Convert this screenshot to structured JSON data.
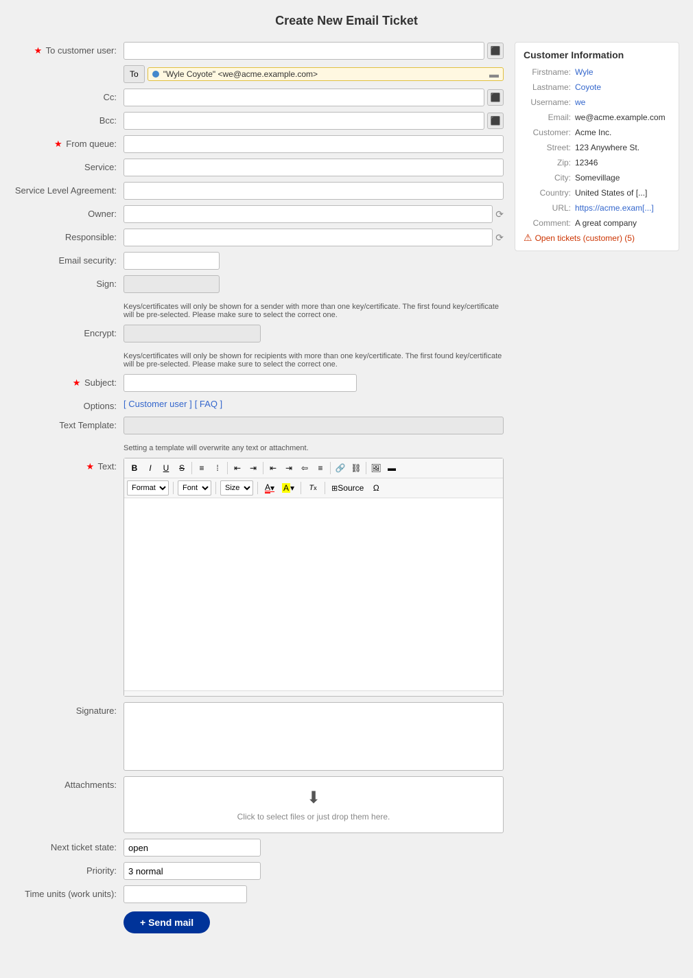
{
  "page": {
    "title": "Create New Email Ticket"
  },
  "form": {
    "to_customer_user_label": "To customer user:",
    "to_label": "To",
    "to_value": "\"Wyle Coyote\" <we@acme.example.com>",
    "cc_label": "Cc:",
    "bcc_label": "Bcc:",
    "from_queue_label": "From queue:",
    "service_label": "Service:",
    "sla_label": "Service Level Agreement:",
    "owner_label": "Owner:",
    "responsible_label": "Responsible:",
    "email_security_label": "Email security:",
    "sign_label": "Sign:",
    "sign_note": "Keys/certificates will only be shown for a sender with more than one key/certificate. The first found key/certificate will be pre-selected. Please make sure to select the correct one.",
    "encrypt_label": "Encrypt:",
    "encrypt_note": "Keys/certificates will only be shown for recipients with more than one key/certificate. The first found key/certificate will be pre-selected. Please make sure to select the correct one.",
    "subject_label": "Subject:",
    "options_label": "Options:",
    "options_links": [
      "[ Customer user ]",
      "[ FAQ ]"
    ],
    "text_template_label": "Text Template:",
    "text_template_note": "Setting a template will overwrite any text or attachment.",
    "text_label": "Text:",
    "signature_label": "Signature:",
    "attachments_label": "Attachments:",
    "attachments_hint": "Click to select files or just drop them here.",
    "next_ticket_state_label": "Next ticket state:",
    "next_ticket_state_value": "open",
    "priority_label": "Priority:",
    "priority_value": "3 normal",
    "time_units_label": "Time units (work units):",
    "send_button_label": "+ Send mail"
  },
  "toolbar": {
    "bold": "B",
    "italic": "I",
    "underline": "U",
    "strikethrough": "S",
    "ordered_list": "ol",
    "unordered_list": "ul",
    "indent_left": "←",
    "indent_right": "→",
    "align_left": "≡",
    "align_center": "≡",
    "align_right": "≡",
    "align_justify": "≡",
    "link": "🔗",
    "unlink": "🔗",
    "image": "🖼",
    "rule": "—",
    "format_label": "Format",
    "font_label": "Font",
    "size_label": "Size",
    "font_color": "A",
    "bg_color": "A",
    "clear_format": "Tx",
    "source_label": "Source",
    "special_chars": "Ω"
  },
  "customer_info": {
    "title": "Customer Information",
    "firstname_label": "Firstname:",
    "firstname_value": "Wyle",
    "lastname_label": "Lastname:",
    "lastname_value": "Coyote",
    "username_label": "Username:",
    "username_value": "we",
    "email_label": "Email:",
    "email_value": "we@acme.example.com",
    "customer_label": "Customer:",
    "customer_value": "Acme Inc.",
    "street_label": "Street:",
    "street_value": "123 Anywhere St.",
    "zip_label": "Zip:",
    "zip_value": "12346",
    "city_label": "City:",
    "city_value": "Somevillage",
    "country_label": "Country:",
    "country_value": "United States of [...]",
    "url_label": "URL:",
    "url_value": "https://acme.exam[...]",
    "comment_label": "Comment:",
    "comment_value": "A great company",
    "open_tickets_label": "Open tickets (customer) (5)"
  }
}
